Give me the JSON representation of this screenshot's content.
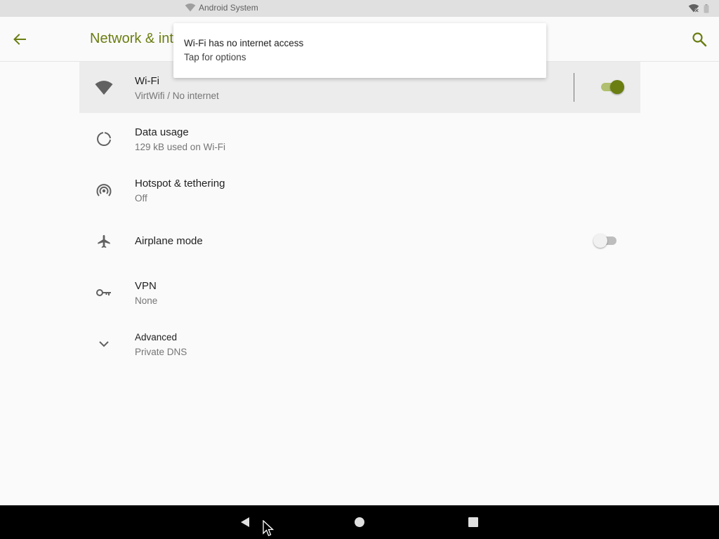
{
  "status_bar": {
    "app_name": "Android System"
  },
  "app_bar": {
    "title": "Network & internet"
  },
  "notification": {
    "title": "Wi-Fi has no internet access",
    "text": "Tap for options"
  },
  "settings": {
    "wifi": {
      "title": "Wi-Fi",
      "summary": "VirtWifi / No internet",
      "enabled": true
    },
    "data_usage": {
      "title": "Data usage",
      "summary": "129 kB used on Wi-Fi"
    },
    "hotspot": {
      "title": "Hotspot & tethering",
      "summary": "Off"
    },
    "airplane": {
      "title": "Airplane mode",
      "enabled": false
    },
    "vpn": {
      "title": "VPN",
      "summary": "None"
    },
    "advanced": {
      "title": "Advanced",
      "summary": "Private DNS"
    }
  },
  "icons": {
    "back": "arrow-back-icon",
    "search": "search-icon",
    "wifi": "wifi-icon",
    "data_usage": "data-usage-icon",
    "hotspot": "hotspot-icon",
    "airplane": "airplane-icon",
    "vpn": "key-icon",
    "advanced": "chevron-down-icon"
  },
  "colors": {
    "accent": "#6a7e12",
    "switch_track_on": "#b0c070",
    "highlight_row": "#ececec",
    "nav_bar": "#000000"
  }
}
